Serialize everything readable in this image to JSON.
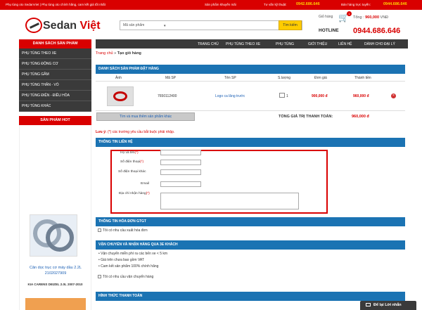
{
  "topbar": {
    "left_text": "Phụ tùng oto SedanViet | Phụ tùng oto chính hãng, cam kết giá tốt nhất",
    "promo": "Sản phẩm khuyến mãi",
    "advice_label": "Tư vấn kỹ thuật:",
    "advice_phone": "0942.686.646",
    "sales_label": "Bán hàng trực tuyến:",
    "sales_phone": "0944.686.646"
  },
  "header": {
    "logo_a": "Sedan",
    "logo_b": "Việt",
    "search_placeholder": "Mã sản phẩm",
    "search_button": "Tìm kiếm",
    "cart_label": "Giỏ hàng",
    "cart_count": "1",
    "total_label": "Tổng :",
    "total_value": "960,000",
    "total_unit": "VNĐ",
    "hotline_label": "HOTLINE",
    "hotline_number": "0944.686.646"
  },
  "nav": [
    "TRANG CHỦ",
    "PHỤ TÙNG THEO XE",
    "PHỤ TÙNG",
    "GIỚI THIỆU",
    "LIÊN HỆ",
    "DÀNH CHO ĐẠI LÝ"
  ],
  "sidebar": {
    "title": "DANH SÁCH SẢN PHẨM",
    "items": [
      "PHỤ TÙNG THEO XE",
      "PHỤ TÙNG ĐỘNG CƠ",
      "PHỤ TÙNG GẦM",
      "PHỤ TÙNG THÂN - VỎ",
      "PHỤ TÙNG ĐIỆN - ĐIỀU HÒA",
      "PHỤ TÙNG KHÁC"
    ],
    "hot_title": "SẢN PHẨM HOT",
    "hot_product_name": "Căn dọc trục cơ máy dầu 2.2L 2102027909",
    "hot_product_sub": "KIA CARENS DEIZEL 2.0L 2007-2010"
  },
  "breadcrumb": {
    "home": "Trang chủ",
    "sep": "»",
    "current": "Tạo giỏ hàng"
  },
  "order": {
    "section_title": "DANH SÁCH SẢN PHẨM ĐẶT HÀNG",
    "columns": [
      "Ảnh",
      "Mã SP",
      "Tên SP",
      "S.lượng",
      "Đơn giá",
      "Thành tiền"
    ],
    "row": {
      "code": "7650112400",
      "name": "Logo ca lăng trước",
      "qty": "1",
      "price": "900,000 đ",
      "total": "960,000 đ"
    },
    "continue_button": "Tìm và mua thêm sản phẩm khác",
    "total_label": "TỔNG GIÁ TRỊ THANH TOÁN:",
    "total_value": "960,000 đ"
  },
  "note": {
    "label": "Lưu ý:",
    "text": "(*) các trường yêu cầu bắt buộc phải nhập."
  },
  "customer": {
    "section_title": "THÔNG TIN LIÊN HỆ",
    "fields": [
      "Họ và tên",
      "Số điện thoại",
      "Số điện thoại khác",
      "Email",
      "Địa chỉ nhận hàng"
    ],
    "required_mark": "(*)"
  },
  "invoice": {
    "section_title": "THÔNG TIN HÓA ĐƠN GTGT",
    "checkbox": "Tôi có nhu cầu xuất hóa đơn"
  },
  "shipping": {
    "section_title": "VẬN CHUYỂN VÀ NHẬN HÀNG QUA 3E KHÁCH",
    "bullets": [
      "Vận chuyển miễn phí ra các bến xe < 5 km",
      "Giá trên chưa bao gồm VAT",
      "Cam kết sản phẩm 100% chính hãng"
    ],
    "checkbox": "Tôi có nhu cầu vận chuyển hàng"
  },
  "payment": {
    "section_title": "HÌNH THỨC THANH TOÁN"
  },
  "chat": {
    "label": "Để lại Lời nhắn"
  },
  "colors": {
    "brand_red": "#d90000",
    "nav_dark": "#3a3a3a",
    "section_blue": "#1b73b3",
    "accent_yellow": "#ffcc00"
  }
}
